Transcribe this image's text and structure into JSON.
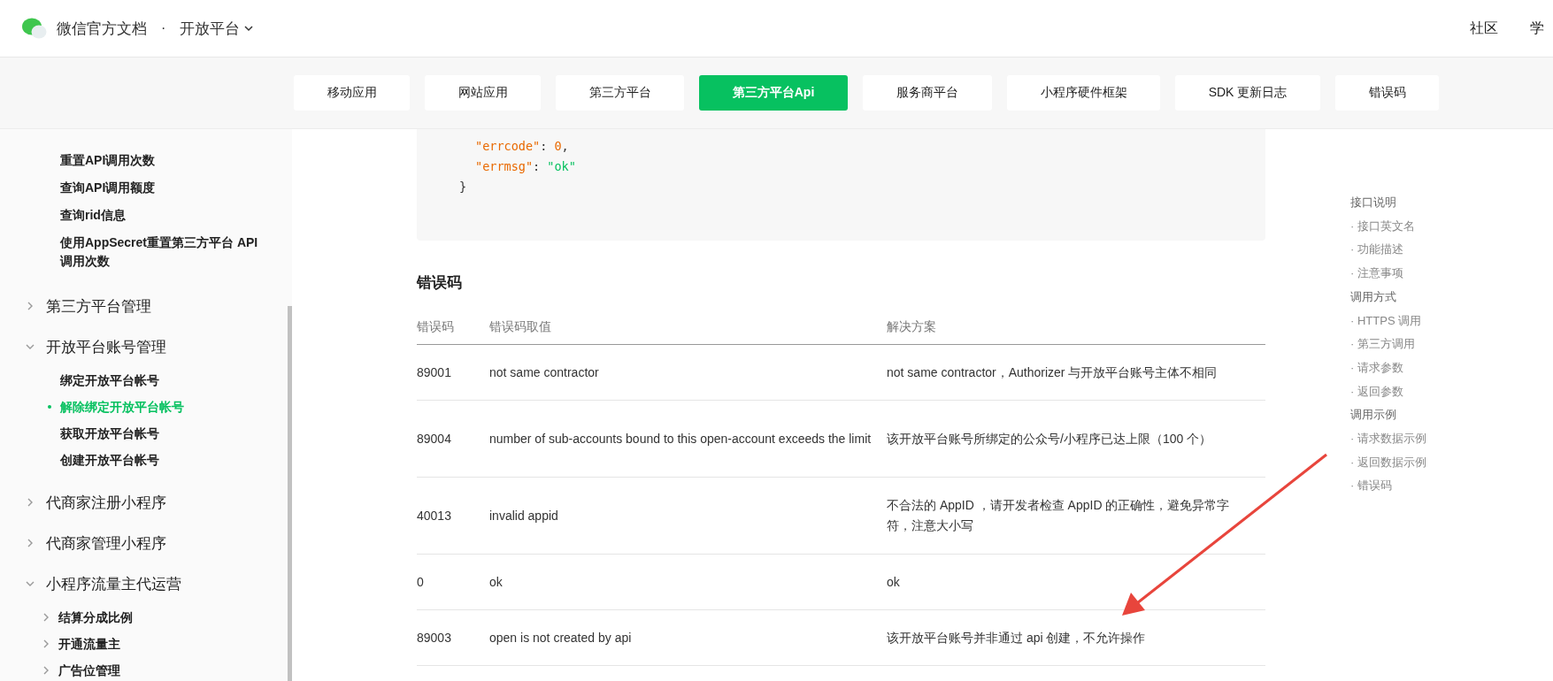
{
  "header": {
    "site_title": "微信官方文档",
    "separator": "·",
    "section": "开放平台",
    "links": [
      "社区",
      "学"
    ]
  },
  "nav_tabs": [
    {
      "label": "移动应用",
      "selected": false
    },
    {
      "label": "网站应用",
      "selected": false
    },
    {
      "label": "第三方平台",
      "selected": false
    },
    {
      "label": "第三方平台Api",
      "selected": true
    },
    {
      "label": "服务商平台",
      "selected": false
    },
    {
      "label": "小程序硬件框架",
      "selected": false
    },
    {
      "label": "SDK 更新日志",
      "selected": false
    },
    {
      "label": "错误码",
      "selected": false
    }
  ],
  "sidebar": {
    "top_items": [
      {
        "label": "重置API调用次数",
        "selected": false
      },
      {
        "label": "查询API调用额度",
        "selected": false
      },
      {
        "label": "查询rid信息",
        "selected": false
      },
      {
        "label": "使用AppSecret重置第三方平台 API调用次数",
        "selected": false
      }
    ],
    "groups": [
      {
        "label": "第三方平台管理",
        "expanded": false
      },
      {
        "label": "开放平台账号管理",
        "expanded": true,
        "children": [
          {
            "label": "绑定开放平台帐号",
            "selected": false
          },
          {
            "label": "解除绑定开放平台帐号",
            "selected": true
          },
          {
            "label": "获取开放平台帐号",
            "selected": false
          },
          {
            "label": "创建开放平台帐号",
            "selected": false
          }
        ]
      },
      {
        "label": "代商家注册小程序",
        "expanded": false
      },
      {
        "label": "代商家管理小程序",
        "expanded": false
      },
      {
        "label": "小程序流量主代运营",
        "expanded": true,
        "children": [
          {
            "label": "结算分成比例",
            "selected": false,
            "expanded": false
          },
          {
            "label": "开通流量主",
            "selected": false,
            "expanded": false
          },
          {
            "label": "广告位管理",
            "selected": false,
            "expanded": false
          }
        ]
      }
    ]
  },
  "code_block": {
    "lines": [
      [
        {
          "kind": "key",
          "text": "\"errcode\""
        },
        {
          "kind": "punct",
          "text": ": "
        },
        {
          "kind": "number",
          "text": "0"
        },
        {
          "kind": "punct",
          "text": ","
        }
      ],
      [
        {
          "kind": "key",
          "text": "\"errmsg\""
        },
        {
          "kind": "punct",
          "text": ": "
        },
        {
          "kind": "string",
          "text": "\"ok\""
        }
      ],
      [
        {
          "kind": "punct",
          "text": "}"
        }
      ]
    ]
  },
  "error_section": {
    "title": "错误码",
    "table": {
      "columns": [
        "错误码",
        "错误码取值",
        "解决方案"
      ],
      "rows": [
        [
          "89001",
          "not same contractor",
          "not same contractor，Authorizer 与开放平台账号主体不相同"
        ],
        [
          "89004",
          "number of sub-accounts bound to this open-account exceeds the limit",
          "该开放平台账号所绑定的公众号/小程序已达上限（100 个）"
        ],
        [
          "40013",
          "invalid appid",
          "不合法的 AppID ，请开发者检查 AppID 的正确性，避免异常字符，注意大小写"
        ],
        [
          "0",
          "ok",
          "ok"
        ],
        [
          "89003",
          "open is not created by api",
          "该开放平台账号并非通过 api 创建，不允许操作"
        ]
      ]
    }
  },
  "toc": [
    {
      "label": "接口说明",
      "kind": "section"
    },
    {
      "label": "· 接口英文名",
      "kind": "sub"
    },
    {
      "label": "· 功能描述",
      "kind": "sub"
    },
    {
      "label": "· 注意事项",
      "kind": "sub"
    },
    {
      "label": "调用方式",
      "kind": "section"
    },
    {
      "label": "· HTTPS 调用",
      "kind": "sub"
    },
    {
      "label": "· 第三方调用",
      "kind": "sub"
    },
    {
      "label": "· 请求参数",
      "kind": "sub"
    },
    {
      "label": "· 返回参数",
      "kind": "sub"
    },
    {
      "label": "调用示例",
      "kind": "section"
    },
    {
      "label": "· 请求数据示例",
      "kind": "sub"
    },
    {
      "label": "· 返回数据示例",
      "kind": "sub"
    },
    {
      "label": "· 错误码",
      "kind": "sub"
    }
  ]
}
